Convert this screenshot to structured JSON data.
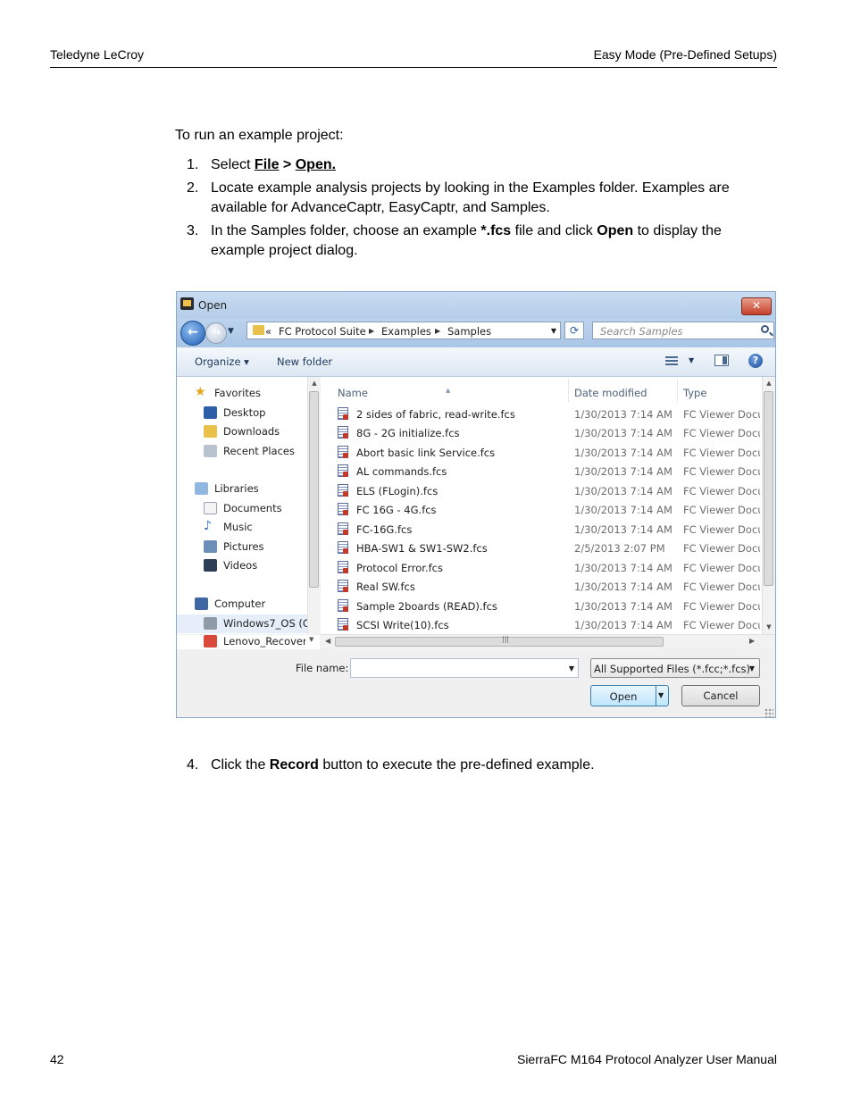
{
  "header": {
    "left": "Teledyne LeCroy",
    "right": "Easy Mode (Pre-Defined Setups)"
  },
  "intro": "To run an example project:",
  "steps": {
    "s1": {
      "num": "1.",
      "a": "Select ",
      "b": "File",
      "c": " > ",
      "d": "Open."
    },
    "s2": {
      "num": "2.",
      "line1": "Locate example analysis projects by looking in the Examples folder. Examples are",
      "line2": "available for AdvanceCaptr, EasyCaptr, and Samples."
    },
    "s3": {
      "num": "3.",
      "a": "In the Samples folder, choose an example ",
      "b": "*.fcs",
      "c": " file and click ",
      "d": "Open",
      "e": " to display the",
      "line2": "example project dialog."
    },
    "s4": {
      "num": "4.",
      "a": "Click the ",
      "b": "Record",
      "c": " button to execute the pre-defined example."
    }
  },
  "dialog": {
    "title": "Open",
    "close": "✕",
    "address": {
      "prefix": "«",
      "segments": [
        "FC Protocol Suite",
        "Examples",
        "Samples"
      ]
    },
    "search_placeholder": "Search Samples",
    "toolbar": {
      "organize": "Organize ▾",
      "new_folder": "New folder"
    },
    "nav": {
      "favorites": "Favorites",
      "desktop": "Desktop",
      "downloads": "Downloads",
      "recent": "Recent Places",
      "libraries": "Libraries",
      "documents": "Documents",
      "music": "Music",
      "pictures": "Pictures",
      "videos": "Videos",
      "computer": "Computer",
      "windows": "Windows7_OS (C",
      "lenovo": "Lenovo_Recovery"
    },
    "columns": {
      "name": "Name",
      "date": "Date modified",
      "type": "Type"
    },
    "files": [
      {
        "name": "2 sides of fabric, read-write.fcs",
        "date": "1/30/2013 7:14 AM",
        "type": "FC Viewer Docu"
      },
      {
        "name": "8G - 2G initialize.fcs",
        "date": "1/30/2013 7:14 AM",
        "type": "FC Viewer Docu"
      },
      {
        "name": "Abort basic link Service.fcs",
        "date": "1/30/2013 7:14 AM",
        "type": "FC Viewer Docu"
      },
      {
        "name": "AL commands.fcs",
        "date": "1/30/2013 7:14 AM",
        "type": "FC Viewer Docu"
      },
      {
        "name": "ELS (FLogin).fcs",
        "date": "1/30/2013 7:14 AM",
        "type": "FC Viewer Docu"
      },
      {
        "name": "FC 16G - 4G.fcs",
        "date": "1/30/2013 7:14 AM",
        "type": "FC Viewer Docu"
      },
      {
        "name": "FC-16G.fcs",
        "date": "1/30/2013 7:14 AM",
        "type": "FC Viewer Docu"
      },
      {
        "name": "HBA-SW1 & SW1-SW2.fcs",
        "date": "2/5/2013 2:07 PM",
        "type": "FC Viewer Docu"
      },
      {
        "name": "Protocol Error.fcs",
        "date": "1/30/2013 7:14 AM",
        "type": "FC Viewer Docu"
      },
      {
        "name": "Real SW.fcs",
        "date": "1/30/2013 7:14 AM",
        "type": "FC Viewer Docu"
      },
      {
        "name": "Sample 2boards (READ).fcs",
        "date": "1/30/2013 7:14 AM",
        "type": "FC Viewer Docu"
      },
      {
        "name": "SCSI Write(10).fcs",
        "date": "1/30/2013 7:14 AM",
        "type": "FC Viewer Docu"
      }
    ],
    "file_name_label": "File name:",
    "file_name_value": "",
    "filter": "All Supported Files (*.fcc;*.fcs)",
    "open": "Open",
    "cancel": "Cancel"
  },
  "footer": {
    "page": "42",
    "title": "SierraFC M164 Protocol Analyzer User Manual"
  }
}
